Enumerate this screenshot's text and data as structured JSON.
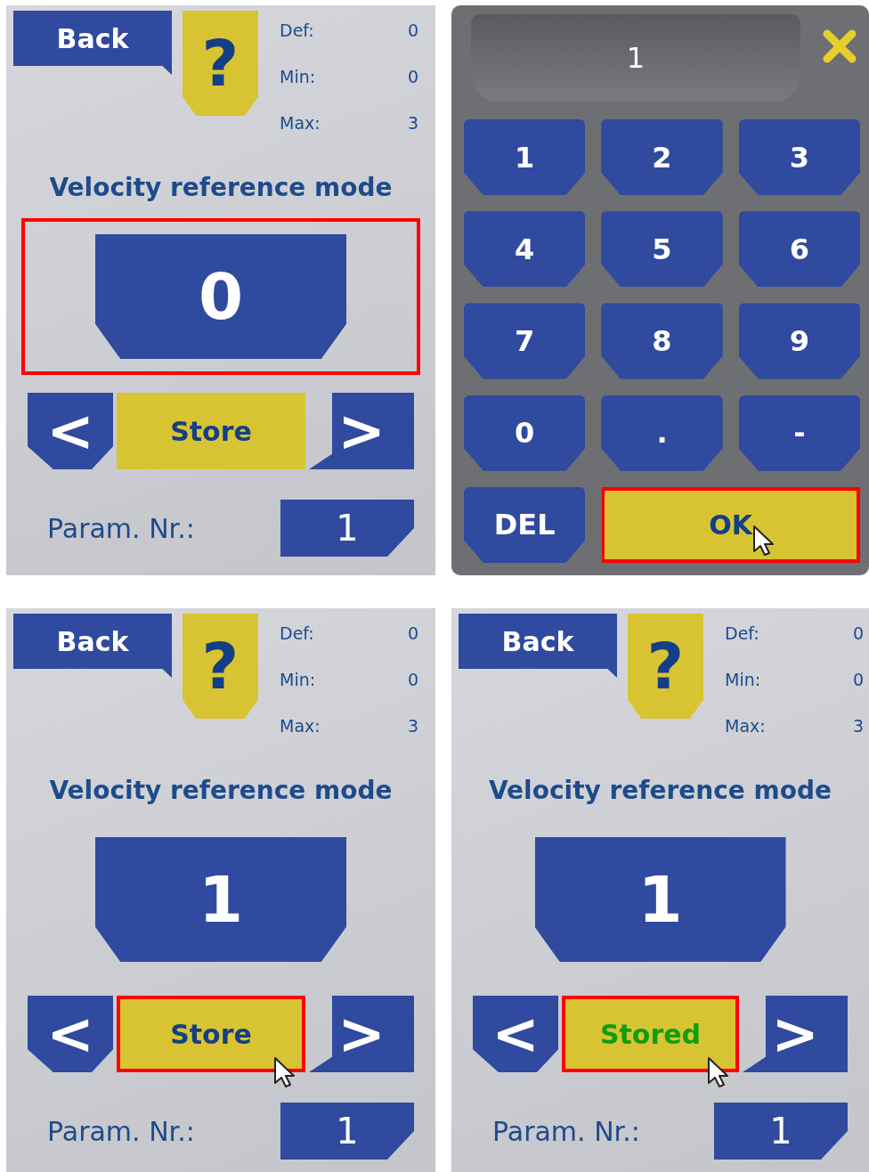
{
  "panels": [
    {
      "kind": "param",
      "back": "Back",
      "help": "?",
      "limits": [
        {
          "label": "Def:",
          "value": "0"
        },
        {
          "label": "Min:",
          "value": "0"
        },
        {
          "label": "Max:",
          "value": "3"
        }
      ],
      "title": "Velocity reference mode",
      "value": "0",
      "prev": "<",
      "store": "Store",
      "stored": false,
      "next": ">",
      "param_label": "Param. Nr.:",
      "param_value": "1",
      "value_highlighted": true,
      "store_highlighted": false,
      "cursor": false
    },
    {
      "kind": "keypad",
      "display": "1",
      "keys": [
        "1",
        "2",
        "3",
        "4",
        "5",
        "6",
        "7",
        "8",
        "9",
        "0",
        ".",
        "-"
      ],
      "del": "DEL",
      "ok": "OK",
      "ok_highlighted": true,
      "cursor": true
    },
    {
      "kind": "param",
      "back": "Back",
      "help": "?",
      "limits": [
        {
          "label": "Def:",
          "value": "0"
        },
        {
          "label": "Min:",
          "value": "0"
        },
        {
          "label": "Max:",
          "value": "3"
        }
      ],
      "title": "Velocity reference mode",
      "value": "1",
      "prev": "<",
      "store": "Store",
      "stored": false,
      "next": ">",
      "param_label": "Param. Nr.:",
      "param_value": "1",
      "value_highlighted": false,
      "store_highlighted": true,
      "cursor": true
    },
    {
      "kind": "param",
      "back": "Back",
      "help": "?",
      "limits": [
        {
          "label": "Def:",
          "value": "0"
        },
        {
          "label": "Min:",
          "value": "0"
        },
        {
          "label": "Max:",
          "value": "3"
        }
      ],
      "title": "Velocity reference mode",
      "value": "1",
      "prev": "<",
      "store": "Stored",
      "stored": true,
      "next": ">",
      "param_label": "Param. Nr.:",
      "param_value": "1",
      "value_highlighted": false,
      "store_highlighted": true,
      "cursor": true
    }
  ]
}
